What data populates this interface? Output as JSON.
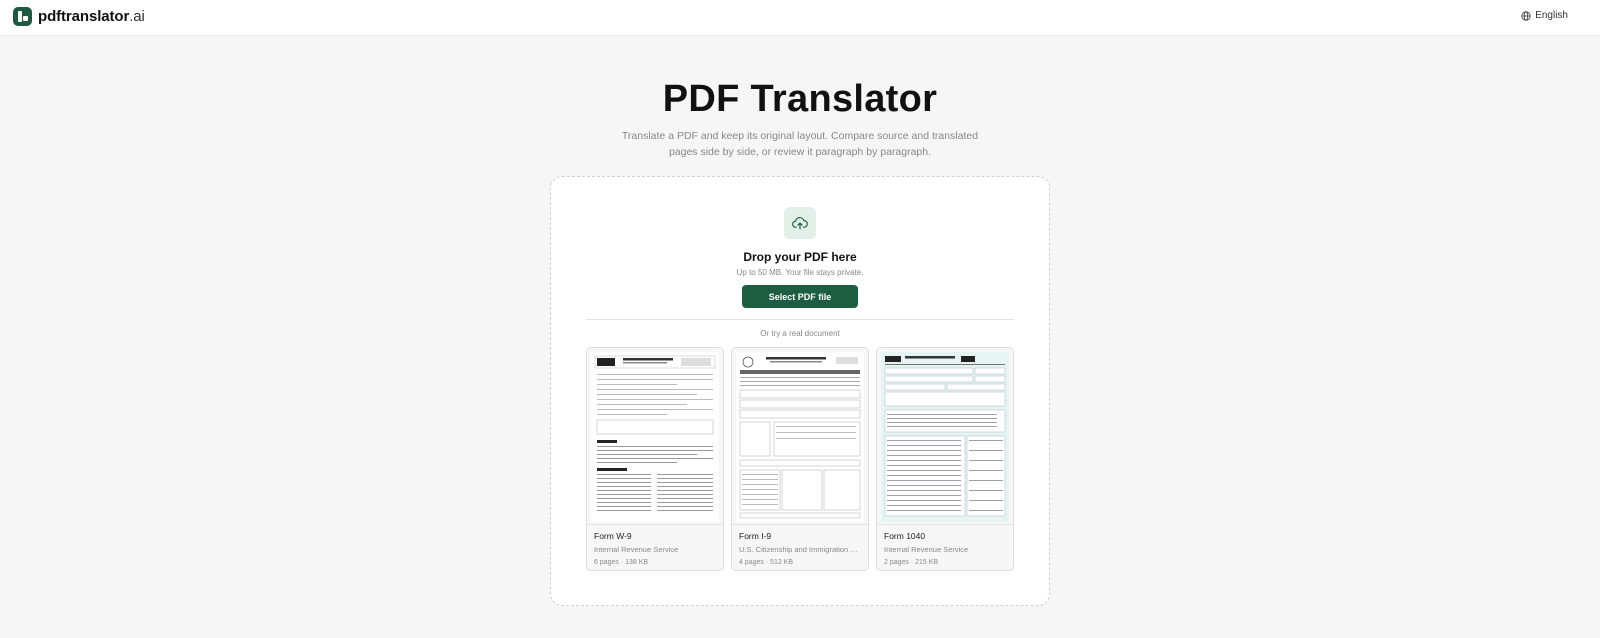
{
  "header": {
    "brand_name": "pdftranslator",
    "brand_suffix": ".ai",
    "language": "English"
  },
  "hero": {
    "title": "PDF Translator",
    "subtitle": "Translate a PDF and keep its original layout. Compare source and translated pages side by side, or review it paragraph by paragraph."
  },
  "upload": {
    "icon": "cloud-upload-icon",
    "title": "Drop your PDF here",
    "subtitle": "Up to 50 MB. Your file stays private.",
    "button_label": "Select PDF file",
    "divider_label": "Or try a real document"
  },
  "samples": [
    {
      "title": "Form W-9",
      "issuer": "Internal Revenue Service",
      "info": "6 pages · 138 KB"
    },
    {
      "title": "Form I-9",
      "issuer": "U.S. Citizenship and Immigration Services",
      "info": "4 pages · 512 KB"
    },
    {
      "title": "Form 1040",
      "issuer": "Internal Revenue Service",
      "info": "2 pages · 215 KB"
    }
  ],
  "colors": {
    "brand_green": "#1d5e42",
    "upload_icon_bg": "#e2f0e8",
    "form_1040_tint": "#e6f5f1"
  }
}
